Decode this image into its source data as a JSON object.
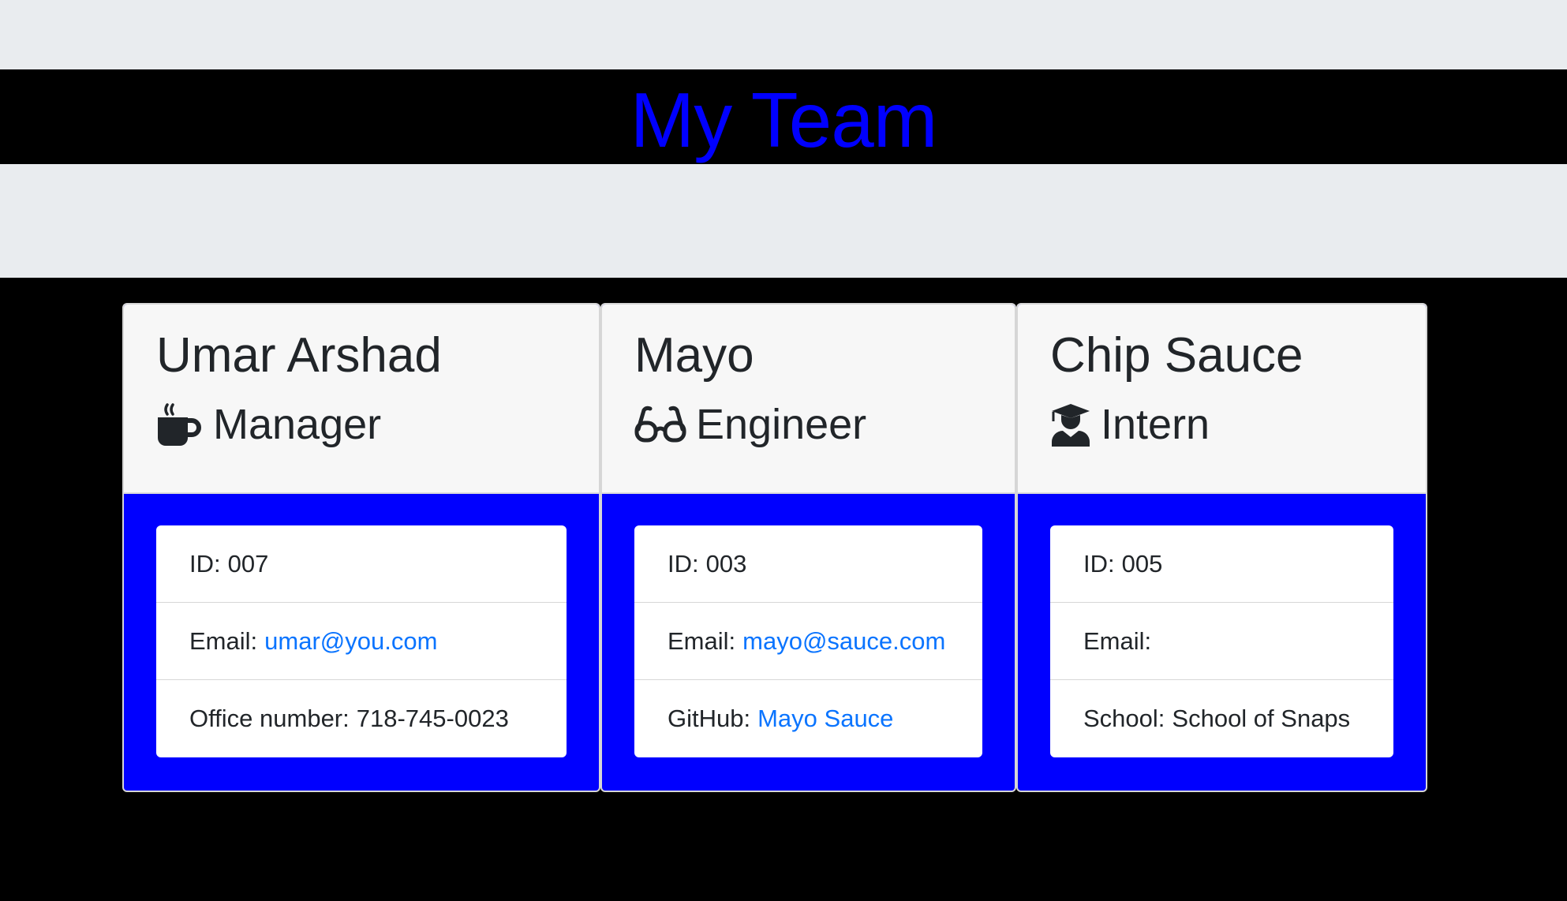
{
  "page": {
    "title": "My Team"
  },
  "colors": {
    "title": "#0000ff",
    "card_body": "#0000ff",
    "link": "#0a74ff",
    "band": "#e9ecef"
  },
  "cards": [
    {
      "name": "Umar Arshad",
      "role": "Manager",
      "role_icon": "coffee-mug-icon",
      "id_label": "ID:",
      "id_value": "007",
      "email_label": "Email:",
      "email_value": "umar@you.com",
      "extra_label": "Office number:",
      "extra_value": "718-745-0023"
    },
    {
      "name": "Mayo",
      "role": "Engineer",
      "role_icon": "glasses-icon",
      "id_label": "ID:",
      "id_value": "003",
      "email_label": "Email:",
      "email_value": "mayo@sauce.com",
      "extra_label": "GitHub:",
      "extra_value": "Mayo Sauce"
    },
    {
      "name": "Chip Sauce",
      "role": "Intern",
      "role_icon": "graduate-icon",
      "id_label": "ID:",
      "id_value": "005",
      "email_label": "Email:",
      "email_value": "",
      "extra_label": "School:",
      "extra_value": "School of Snaps"
    }
  ]
}
